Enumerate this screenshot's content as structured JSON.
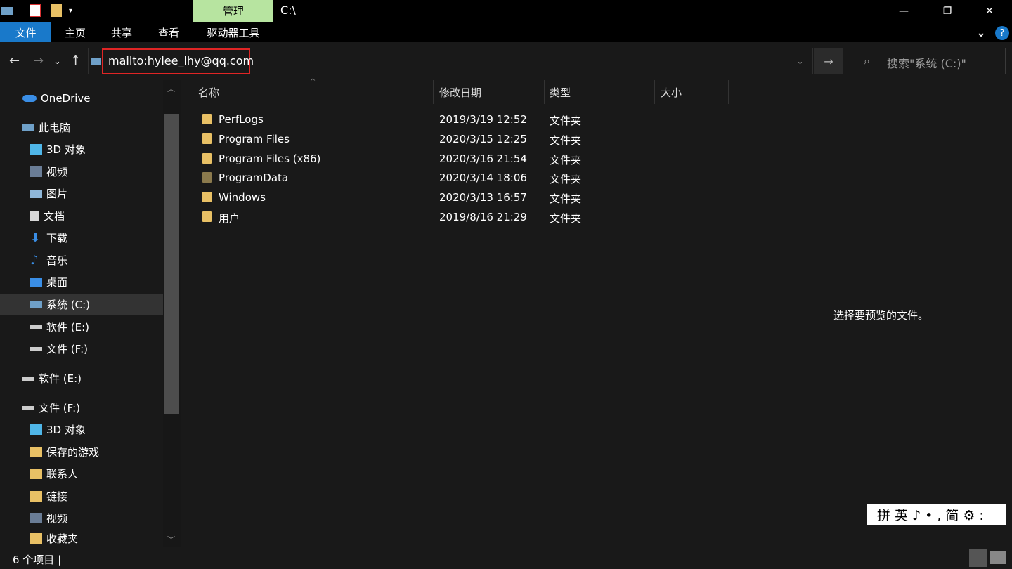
{
  "window": {
    "manage_tab": "管理",
    "title": "C:\\",
    "minimize": "—",
    "restore": "❐",
    "close": "✕"
  },
  "ribbon": {
    "tabs": [
      "文件",
      "主页",
      "共享",
      "查看",
      "驱动器工具"
    ],
    "expand": "⌄",
    "help": "?"
  },
  "address": {
    "value": "mailto:hylee_lhy@qq.com",
    "search_placeholder": "搜索\"系统 (C:)\""
  },
  "nav": {
    "items": [
      {
        "label": "OneDrive"
      },
      {
        "label": "此电脑"
      },
      {
        "label": "3D 对象"
      },
      {
        "label": "视频"
      },
      {
        "label": "图片"
      },
      {
        "label": "文档"
      },
      {
        "label": "下载"
      },
      {
        "label": "音乐"
      },
      {
        "label": "桌面"
      },
      {
        "label": "系统 (C:)"
      },
      {
        "label": "软件 (E:)"
      },
      {
        "label": "文件 (F:)"
      },
      {
        "label": "软件 (E:)"
      },
      {
        "label": "文件 (F:)"
      },
      {
        "label": "3D 对象"
      },
      {
        "label": "保存的游戏"
      },
      {
        "label": "联系人"
      },
      {
        "label": "链接"
      },
      {
        "label": "视频"
      },
      {
        "label": "收藏夹"
      }
    ]
  },
  "columns": {
    "name": "名称",
    "modified": "修改日期",
    "type": "类型",
    "size": "大小"
  },
  "files": [
    {
      "name": "PerfLogs",
      "modified": "2019/3/19 12:52",
      "type": "文件夹"
    },
    {
      "name": "Program Files",
      "modified": "2020/3/15 12:25",
      "type": "文件夹"
    },
    {
      "name": "Program Files (x86)",
      "modified": "2020/3/16 21:54",
      "type": "文件夹"
    },
    {
      "name": "ProgramData",
      "modified": "2020/3/14 18:06",
      "type": "文件夹"
    },
    {
      "name": "Windows",
      "modified": "2020/3/13 16:57",
      "type": "文件夹"
    },
    {
      "name": "用户",
      "modified": "2019/8/16 21:29",
      "type": "文件夹"
    }
  ],
  "preview": {
    "message": "选择要预览的文件。"
  },
  "ime": {
    "text": "拼英♪•,简⚙:"
  },
  "status": {
    "count": "6 个项目  |"
  }
}
